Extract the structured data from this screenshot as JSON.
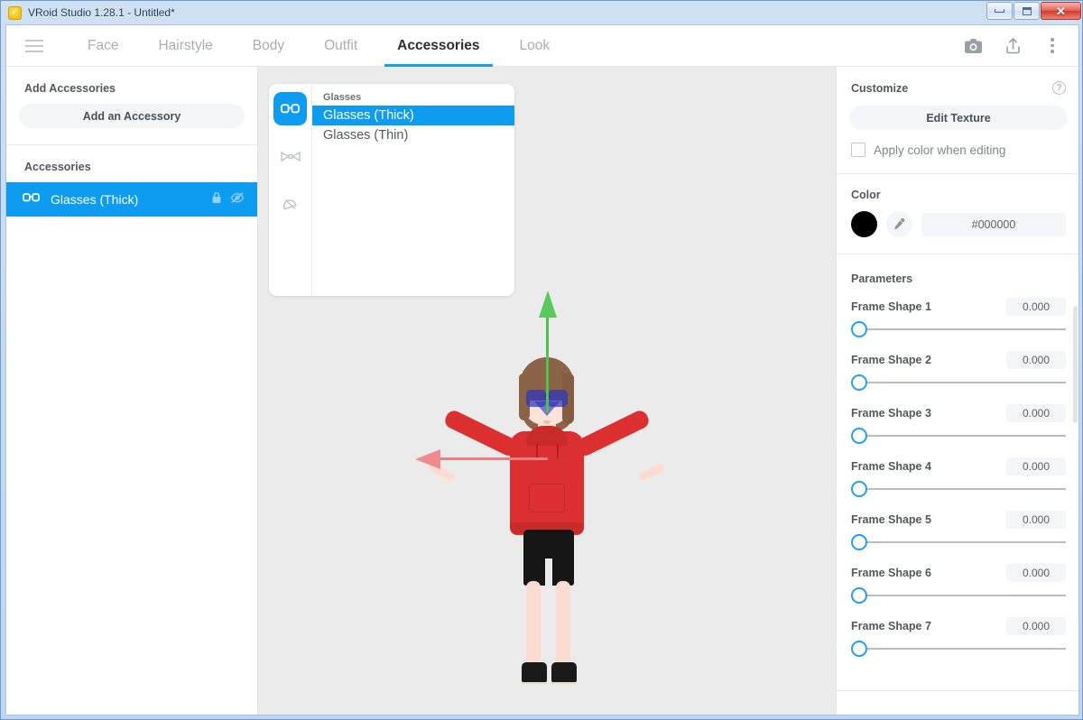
{
  "window": {
    "title": "VRoid Studio 1.28.1 - Untitled*",
    "app_icon": "vroid-logo-icon",
    "controls": {
      "minimize": "minimize-icon",
      "maximize": "maximize-icon",
      "close": "✕"
    }
  },
  "topnav": {
    "menu_icon": "hamburger-icon",
    "tabs": [
      {
        "label": "Face",
        "active": false
      },
      {
        "label": "Hairstyle",
        "active": false
      },
      {
        "label": "Body",
        "active": false
      },
      {
        "label": "Outfit",
        "active": false
      },
      {
        "label": "Accessories",
        "active": true
      },
      {
        "label": "Look",
        "active": false
      }
    ],
    "actions": [
      {
        "name": "camera-icon",
        "label": ""
      },
      {
        "name": "export-icon",
        "label": ""
      },
      {
        "name": "more-options-icon",
        "label": ""
      }
    ]
  },
  "left_panel": {
    "add_section_title": "Add Accessories",
    "add_button": "Add an Accessory",
    "list_section_title": "Accessories",
    "items": [
      {
        "label": "Glasses (Thick)",
        "icon": "glasses-icon",
        "selected": true,
        "lock_icon": "lock-icon",
        "visibility_icon": "eye-off-icon"
      }
    ]
  },
  "picker": {
    "categories": [
      {
        "name": "glasses-category-icon",
        "active": true
      },
      {
        "name": "ribbon-category-icon",
        "active": false
      },
      {
        "name": "hat-category-icon",
        "active": false
      }
    ],
    "group_label": "Glasses",
    "options": [
      {
        "label": "Glasses (Thick)",
        "selected": true
      },
      {
        "label": "Glasses (Thin)",
        "selected": false
      }
    ]
  },
  "viewport": {
    "background": "#ebebeb",
    "gizmo": {
      "y_axis_color": "#5bc85b",
      "x_axis_color": "#f08a8f"
    },
    "character": {
      "hair_color": "#8b6347",
      "skin_color": "#fce3da",
      "hoodie_color": "#dc3030",
      "shorts_color": "#161616",
      "glasses_color": "#2d34be",
      "shoes_color": "#1a1a1a"
    }
  },
  "right_panel": {
    "customize_label": "Customize",
    "help_icon": "help-icon",
    "edit_texture_button": "Edit Texture",
    "apply_color_checkbox": {
      "label": "Apply color when editing",
      "checked": false
    },
    "color_label": "Color",
    "color_swatch": "#000000",
    "eyedropper_icon": "eyedropper-icon",
    "color_hex": "#000000",
    "parameters_label": "Parameters",
    "parameters": [
      {
        "name": "Frame Shape 1",
        "value": "0.000",
        "fraction": 0
      },
      {
        "name": "Frame Shape 2",
        "value": "0.000",
        "fraction": 0
      },
      {
        "name": "Frame Shape 3",
        "value": "0.000",
        "fraction": 0
      },
      {
        "name": "Frame Shape 4",
        "value": "0.000",
        "fraction": 0
      },
      {
        "name": "Frame Shape 5",
        "value": "0.000",
        "fraction": 0
      },
      {
        "name": "Frame Shape 6",
        "value": "0.000",
        "fraction": 0
      },
      {
        "name": "Frame Shape 7",
        "value": "0.000",
        "fraction": 0
      }
    ]
  }
}
